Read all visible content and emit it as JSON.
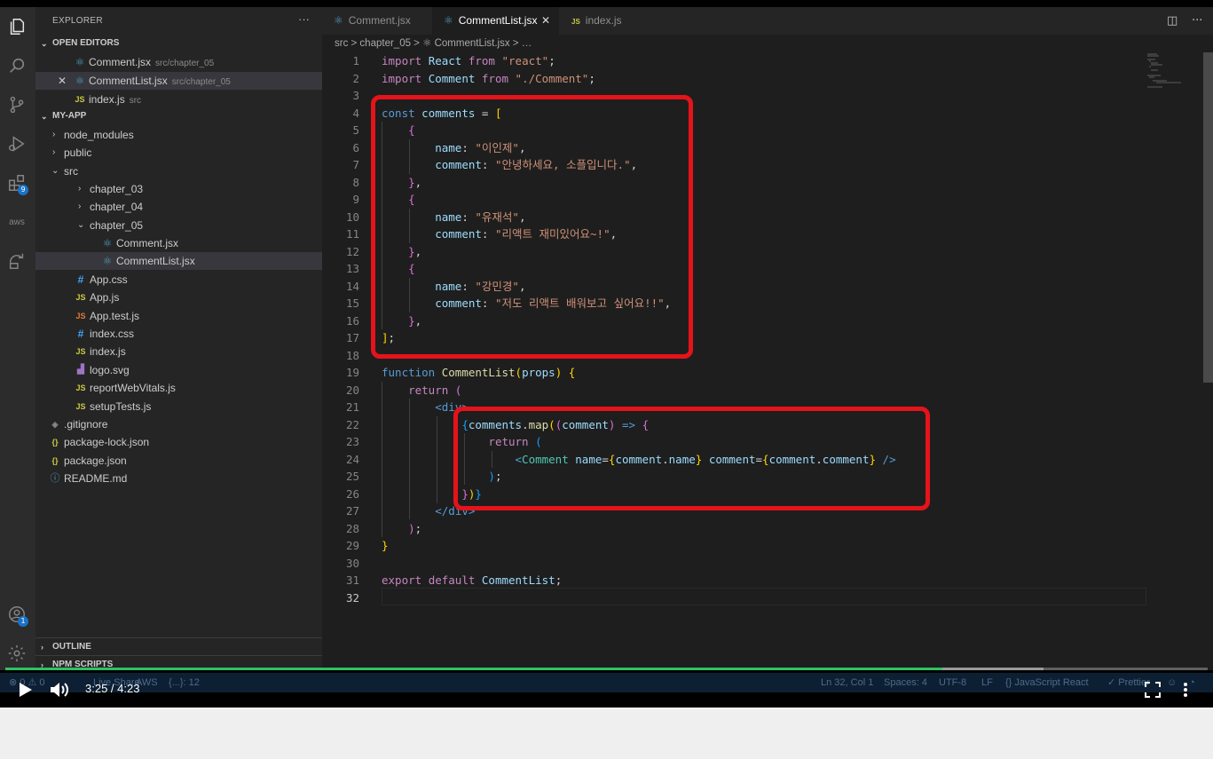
{
  "sidebar": {
    "header": "EXPLORER",
    "more": "···",
    "open_editors_title": "OPEN EDITORS",
    "open_editors": [
      {
        "name": "Comment.jsx",
        "path": "src/chapter_05"
      },
      {
        "name": "CommentList.jsx",
        "path": "src/chapter_05"
      },
      {
        "name": "index.js",
        "path": "src"
      }
    ],
    "project_title": "MY-APP",
    "tree": [
      {
        "label": "node_modules"
      },
      {
        "label": "public"
      },
      {
        "label": "src"
      },
      {
        "label": "chapter_03"
      },
      {
        "label": "chapter_04"
      },
      {
        "label": "chapter_05"
      },
      {
        "label": "Comment.jsx"
      },
      {
        "label": "CommentList.jsx"
      },
      {
        "label": "App.css"
      },
      {
        "label": "App.js"
      },
      {
        "label": "App.test.js"
      },
      {
        "label": "index.css"
      },
      {
        "label": "index.js"
      },
      {
        "label": "logo.svg"
      },
      {
        "label": "reportWebVitals.js"
      },
      {
        "label": "setupTests.js"
      },
      {
        "label": ".gitignore"
      },
      {
        "label": "package-lock.json"
      },
      {
        "label": "package.json"
      },
      {
        "label": "README.md"
      }
    ],
    "outline_title": "OUTLINE",
    "npm_title": "NPM SCRIPTS"
  },
  "activity": {
    "extensions_badge": "9",
    "accounts_badge": "1",
    "aws_label": "aws"
  },
  "tabs": [
    {
      "label": "Comment.jsx"
    },
    {
      "label": "CommentList.jsx"
    },
    {
      "label": "index.js"
    }
  ],
  "breadcrumb": "src > chapter_05 > ⚛ CommentList.jsx > …",
  "editor": {
    "line_numbers": [
      "1",
      "2",
      "3",
      "4",
      "5",
      "6",
      "7",
      "8",
      "9",
      "10",
      "11",
      "12",
      "13",
      "14",
      "15",
      "16",
      "17",
      "18",
      "19",
      "20",
      "21",
      "22",
      "23",
      "24",
      "25",
      "26",
      "27",
      "28",
      "29",
      "30",
      "31",
      "32"
    ],
    "strings": {
      "react": "\"react\"",
      "comment_path": "\"./Comment\"",
      "name1": "\"이인제\"",
      "comment1": "\"안녕하세요, 소플입니다.\"",
      "name2": "\"유재석\"",
      "comment2": "\"리액트 재미있어요~!\"",
      "name3": "\"강민경\"",
      "comment3": "\"저도 리액트 배워보고 싶어요!!\""
    }
  },
  "statusbar": {
    "left1": "⊗ 0 ⚠ 0",
    "live_share": "Live Share",
    "aws": "AWS",
    "braces": "{...}: 12",
    "position": "Ln 32, Col 1",
    "spaces": "Spaces: 4",
    "encoding": "UTF-8",
    "eol": "LF",
    "language": "{} JavaScript React",
    "prettier": "✓ Prettier"
  },
  "video": {
    "time": "3:25 / 4:23",
    "progress": 0.779
  },
  "colors": {
    "highlight_box": "#e5131a",
    "progress": "#2fc265"
  }
}
